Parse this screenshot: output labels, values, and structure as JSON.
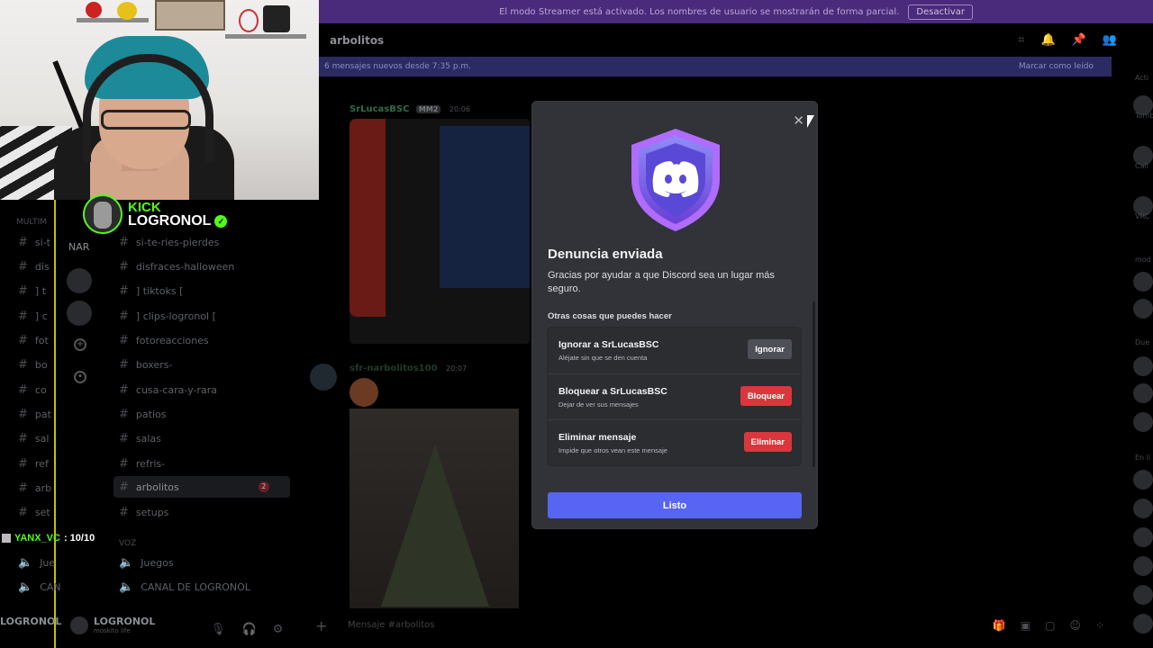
{
  "banner": {
    "text": "El modo Streamer está activado. Los nombres de usuario se mostrarán de forma parcial.",
    "button": "Desactivar"
  },
  "overlay": {
    "brand": "KICK",
    "streamer": "LOGRONOL",
    "rating_user": "YANX_VC",
    "rating_value": ": 10/10",
    "brand_color": "#53fc18"
  },
  "server_bar": {
    "label": "NAR",
    "category": "MULTIM"
  },
  "channels": {
    "left_col": [
      "si-t",
      "dis",
      "] t",
      "] c",
      "fot",
      "bo",
      "co",
      "pat",
      "sal",
      "ref",
      "arb",
      "set",
      "Jue",
      "CAN"
    ],
    "main_col": [
      "si-te-ries-pierdes",
      "disfraces-halloween",
      "] tiktoks [",
      "] clips-logronol [",
      "fotoreacciones",
      "boxers-",
      "cusa-cara-y-rara",
      "patios",
      "salas",
      "refris-",
      "arbolitos",
      "setups"
    ],
    "active": "arbolitos",
    "active_badge": "2",
    "voice_category": "VOZ",
    "voice": [
      "Juegos",
      "CANAL DE LOGRONOL"
    ]
  },
  "user_bar": {
    "left_name": "LOGRONOL",
    "name": "LOGRONOL",
    "status": "moskito life"
  },
  "chat": {
    "channel_title": "arbolitos",
    "new_messages": "6 mensajes nuevos desde 7:35 p.m.",
    "mark_read": "Marcar como leído",
    "author1": "SrLucasBSC",
    "author1_tag": "MM2",
    "author1_time": "20:06",
    "author2": "sfr-narbolitos100",
    "author2_time": "20:07",
    "composer_placeholder": "Mensaje #arbolitos"
  },
  "right_list": [
    "Acti",
    "Tomb",
    "Call",
    "VRC",
    "mod",
    "Due",
    "En lí"
  ],
  "modal": {
    "title": "Denuncia enviada",
    "description": "Gracias por ayudar a que Discord sea un lugar más seguro.",
    "section_title": "Otras cosas que puedes hacer",
    "options": [
      {
        "title": "Ignorar a SrLucasBSC",
        "subtitle": "Aléjate sin que se den cuenta",
        "button": "Ignorar"
      },
      {
        "title": "Bloquear a SrLucasBSC",
        "subtitle": "Dejar de ver sus mensajes",
        "button": "Bloquear"
      },
      {
        "title": "Eliminar mensaje",
        "subtitle": "Impide que otros vean este mensaje",
        "button": "Eliminar"
      }
    ],
    "done_button": "Listo",
    "close_icon": "close-icon",
    "shield_icon": "discord-shield-icon",
    "colors": {
      "primary": "#5865f2",
      "danger": "#da373c",
      "surface": "#313338"
    }
  }
}
